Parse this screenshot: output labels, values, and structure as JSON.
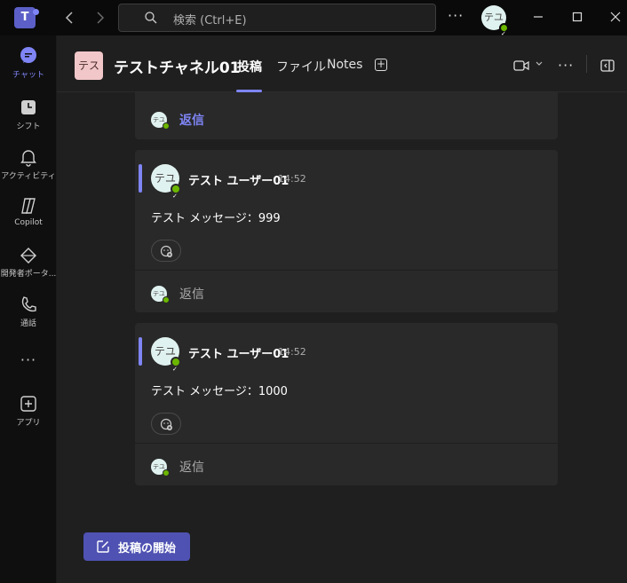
{
  "titlebar": {
    "app_logo": "T",
    "search_placeholder": "検索 (Ctrl+E)",
    "more": "···",
    "user_avatar": "テユ",
    "icons": [
      "teams-logo-icon",
      "back-arrow-icon",
      "forward-arrow-icon",
      "search-icon",
      "more-icon",
      "minimize-icon",
      "maximize-icon",
      "close-icon"
    ]
  },
  "rail": {
    "items": [
      {
        "label": "チャット",
        "icon": "chat-icon",
        "active": true
      },
      {
        "label": "シフト",
        "icon": "shifts-icon"
      },
      {
        "label": "アクティビティ",
        "icon": "bell-icon"
      },
      {
        "label": "Copilot",
        "icon": "copilot-icon"
      },
      {
        "label": "開発者ポータ...",
        "icon": "developer-portal-icon"
      },
      {
        "label": "通話",
        "icon": "phone-icon"
      },
      {
        "label": "アプリ",
        "icon": "add-apps-icon"
      }
    ],
    "more": "···"
  },
  "channel": {
    "avatar": "テス",
    "title": "テストチャネル01",
    "tabs": [
      {
        "label": "投稿",
        "active": true
      },
      {
        "label": "ファイル"
      },
      {
        "label": "Notes"
      }
    ],
    "add_tab": "+"
  },
  "messages": {
    "top_reply": {
      "avatar": "テユ",
      "label": "返信"
    },
    "posts": [
      {
        "avatar": "テユ",
        "author": "テスト ユーザー01",
        "time": "14:52",
        "body": "テスト メッセージ：999",
        "reply_avatar": "テユ",
        "reply_label": "返信"
      },
      {
        "avatar": "テユ",
        "author": "テスト ユーザー01",
        "time": "14:52",
        "body": "テスト メッセージ：1000",
        "reply_avatar": "テユ",
        "reply_label": "返信"
      }
    ]
  },
  "new_post_button": {
    "label": "投稿の開始",
    "icon": "compose-icon"
  },
  "colors": {
    "accent": "#7f85f5",
    "button": "#4f52b2",
    "presence": "#6bb700",
    "background": "#1f1f1f",
    "card": "#292929"
  }
}
